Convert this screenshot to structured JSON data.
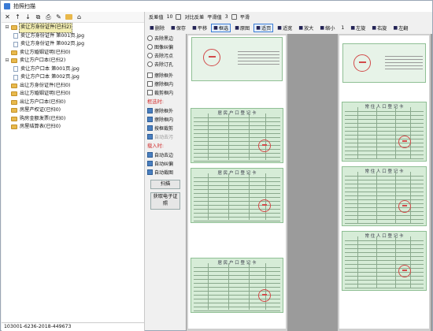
{
  "window": {
    "title": "拍照扫描"
  },
  "tree_toolbar": {
    "items": [
      "✕",
      "↑",
      "↓",
      "⧉",
      "⎙",
      "✎",
      "▭",
      "⌂"
    ]
  },
  "tree": [
    {
      "level": 1,
      "label": "卖让方身份证件(已扫2)",
      "expanded": true,
      "selected": true
    },
    {
      "level": 2,
      "label": "卖让方身份证件 第001页.jpg",
      "doc": true
    },
    {
      "level": 2,
      "label": "卖让方身份证件 第002页.jpg",
      "doc": true
    },
    {
      "level": 1,
      "label": "卖让方婚姻证明(已扫0)"
    },
    {
      "level": 1,
      "label": "卖让方户口本(已扫2)",
      "expanded": true
    },
    {
      "level": 2,
      "label": "卖让方户口本 第001页.jpg",
      "doc": true
    },
    {
      "level": 2,
      "label": "卖让方户口本 第002页.jpg",
      "doc": true
    },
    {
      "level": 1,
      "label": "出让方身份证件(已扫0)"
    },
    {
      "level": 1,
      "label": "出让方婚姻证明(已扫0)"
    },
    {
      "level": 1,
      "label": "出让方户口本(已扫0)"
    },
    {
      "level": 1,
      "label": "房屋产权证(已扫0)"
    },
    {
      "level": 1,
      "label": "购房金额发票(已扫0)"
    },
    {
      "level": 1,
      "label": "房屋结算表(已扫0)"
    }
  ],
  "status": {
    "text": "103001-6236-2018-449673"
  },
  "topbar": {
    "threshold_label": "反差值",
    "threshold_value": "10",
    "contrast_label": "对比反差",
    "smooth_label": "平滑值",
    "smooth_value": "3",
    "smooth2_label": "平滑"
  },
  "viewbar": {
    "buttons": [
      {
        "label": "删除",
        "active": false
      },
      {
        "label": "保存",
        "active": false
      },
      {
        "label": "平移",
        "active": false
      },
      {
        "label": "框选",
        "active": true
      },
      {
        "label": "原图",
        "active": false
      },
      {
        "label": "适页",
        "active": true
      },
      {
        "label": "适宽",
        "active": false
      },
      {
        "label": "放大",
        "active": false
      },
      {
        "label": "缩小",
        "active": false
      },
      {
        "label": "1",
        "active": false
      },
      {
        "label": "左旋",
        "active": false
      },
      {
        "label": "右旋",
        "active": false
      },
      {
        "label": "左翻",
        "active": false
      }
    ]
  },
  "tools": {
    "group1": [
      "去除黑边",
      "图像纠偏",
      "去除污点",
      "去除订孔"
    ],
    "group2": [
      "擦除框外",
      "擦除框内",
      "裁剪框内"
    ],
    "group3_title": "框选时:",
    "group3": [
      "擦除框外",
      "擦除框内",
      "按框裁剪",
      "自动去污"
    ],
    "group4_title": "载入时:",
    "group4": [
      "自动去边",
      "自动纠偏",
      "自动裁图"
    ],
    "scan_button": "扫描",
    "fetch_button": "获取电子证照"
  },
  "cards": {
    "title": "居 民 户 口 登 记 卡",
    "title2": "常 住 人 口 登 记 卡",
    "stamp_text": "户口专用"
  }
}
